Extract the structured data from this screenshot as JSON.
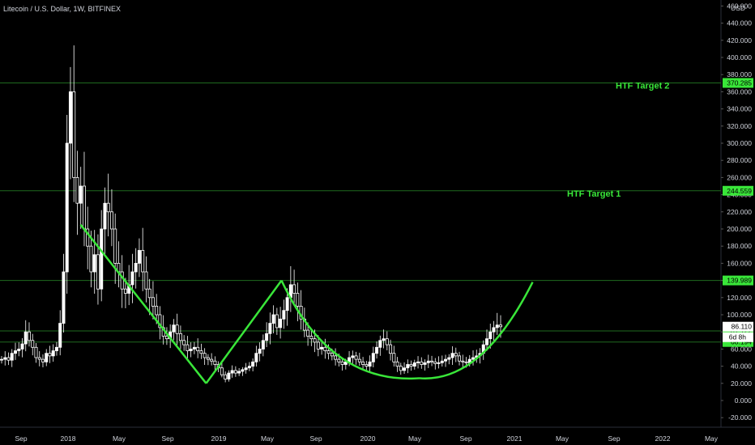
{
  "header": {
    "title": "Litecoin / U.S. Dollar, 1W, BITFINEX",
    "currency": "USD"
  },
  "colors": {
    "background": "#000000",
    "candle_up": "#ffffff",
    "candle_down": "#ffffff",
    "trend_line": "#39e639",
    "level_line": "#1f6b1f",
    "label_green": "#39e639",
    "text": "#d1d4dc"
  },
  "chart_data": {
    "type": "candlestick",
    "title": "Litecoin / U.S. Dollar, 1W, BITFINEX",
    "ylabel": "USD",
    "ylim": [
      -30,
      460
    ],
    "y_ticks": [
      "-20.000",
      "0.000",
      "20.000",
      "40.000",
      "60.000",
      "80.000",
      "100.000",
      "120.000",
      "140.000",
      "160.000",
      "180.000",
      "200.000",
      "220.000",
      "240.000",
      "260.000",
      "280.000",
      "300.000",
      "320.000",
      "340.000",
      "360.000",
      "380.000",
      "400.000",
      "420.000",
      "440.000",
      "460.000"
    ],
    "x_ticks": [
      "Sep",
      "2018",
      "May",
      "Sep",
      "2019",
      "May",
      "Sep",
      "2020",
      "May",
      "Sep",
      "2021",
      "May",
      "Sep",
      "2022",
      "May"
    ],
    "price_levels": [
      {
        "value": 370.285,
        "label": "370.285",
        "annotation": "HTF Target 2"
      },
      {
        "value": 244.559,
        "label": "244.559",
        "annotation": "HTF Target 1"
      },
      {
        "value": 139.989,
        "label": "139.989",
        "annotation": ""
      },
      {
        "value": 81.122,
        "label": "81.122",
        "annotation": ""
      },
      {
        "value": 68.194,
        "label": "68.194",
        "annotation": ""
      }
    ],
    "current_price": {
      "value": 86.11,
      "label": "86.110",
      "countdown": "6d 8h"
    },
    "weekly_close_series": [
      48,
      50,
      47,
      55,
      58,
      60,
      66,
      80,
      70,
      62,
      50,
      48,
      45,
      55,
      52,
      58,
      62,
      90,
      150,
      300,
      360,
      260,
      230,
      250,
      200,
      180,
      150,
      170,
      130,
      200,
      230,
      220,
      200,
      160,
      150,
      130,
      125,
      135,
      150,
      160,
      175,
      150,
      130,
      120,
      110,
      100,
      85,
      75,
      72,
      80,
      88,
      78,
      70,
      65,
      58,
      60,
      62,
      58,
      55,
      50,
      48,
      46,
      42,
      38,
      30,
      25,
      32,
      35,
      32,
      34,
      36,
      38,
      40,
      45,
      55,
      60,
      70,
      78,
      90,
      100,
      85,
      95,
      105,
      120,
      135,
      125,
      110,
      95,
      82,
      75,
      72,
      68,
      60,
      62,
      58,
      55,
      52,
      48,
      45,
      42,
      45,
      50,
      52,
      48,
      45,
      42,
      40,
      45,
      55,
      62,
      70,
      72,
      65,
      55,
      45,
      40,
      35,
      38,
      42,
      40,
      44,
      45,
      42,
      44,
      46,
      45,
      43,
      44,
      46,
      48,
      50,
      55,
      52,
      46,
      45,
      44,
      48,
      50,
      52,
      55,
      65,
      72,
      80,
      85,
      88,
      86
    ],
    "trend_lines": [
      {
        "from": {
          "date": "2018-02",
          "value": 205
        },
        "to": {
          "date": "2018-12",
          "value": 20
        }
      },
      {
        "from": {
          "date": "2018-12",
          "value": 20
        },
        "to": {
          "date": "2019-06",
          "value": 140
        }
      },
      {
        "from": {
          "date": "2019-06",
          "value": 140
        },
        "to": {
          "date": "2020-05",
          "value": 26
        },
        "shape": "curve"
      },
      {
        "from": {
          "date": "2020-05",
          "value": 26
        },
        "to": {
          "date": "2021-02",
          "value": 138
        },
        "shape": "curve"
      }
    ]
  }
}
